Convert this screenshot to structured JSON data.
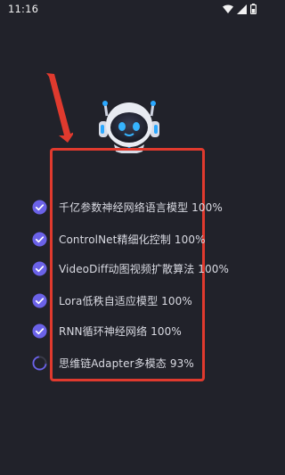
{
  "status_bar": {
    "time": "11:16",
    "icons": [
      "wifi-icon",
      "signal-icon",
      "battery-icon"
    ]
  },
  "colors": {
    "background": "#21222a",
    "check_accent": "#6b62e8",
    "highlight_box": "#e03a2e",
    "arrow": "#e03a2e"
  },
  "tasks": [
    {
      "label": "千亿参数神经网络语言模型",
      "percent": "100%",
      "status": "done"
    },
    {
      "label": "ControlNet精细化控制",
      "percent": "100%",
      "status": "done"
    },
    {
      "label": "VideoDiff动图视频扩散算法",
      "percent": "100%",
      "status": "done"
    },
    {
      "label": "Lora低秩自适应模型",
      "percent": "100%",
      "status": "done"
    },
    {
      "label": "RNN循环神经网络",
      "percent": "100%",
      "status": "done"
    },
    {
      "label": "思维链Adapter多模态",
      "percent": "93%",
      "status": "loading"
    }
  ]
}
